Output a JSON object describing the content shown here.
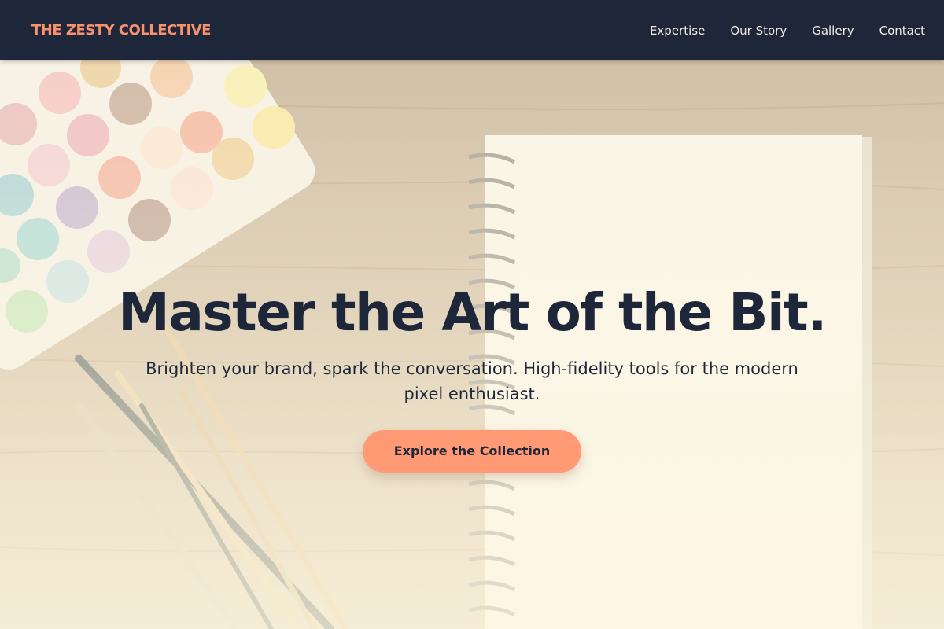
{
  "brand": {
    "name": "THE ZESTY COLLECTIVE"
  },
  "nav": {
    "items": [
      {
        "label": "Expertise"
      },
      {
        "label": "Our Story"
      },
      {
        "label": "Gallery"
      },
      {
        "label": "Contact"
      }
    ]
  },
  "hero": {
    "title": "Master the Art of the Bit.",
    "subtitle": "Brighten your brand, spark the conversation. High-fidelity tools for the modern pixel enthusiast.",
    "cta_label": "Explore the Collection",
    "background_image": "watercolor-palette-sketchbook-brushes"
  },
  "colors": {
    "nav_bg": "#1e2739",
    "brand": "#f7926d",
    "nav_text": "#f1ede4",
    "heading": "#1e2739",
    "cta_bg": "#ff9a74",
    "overlay": "#fdf6e0"
  }
}
